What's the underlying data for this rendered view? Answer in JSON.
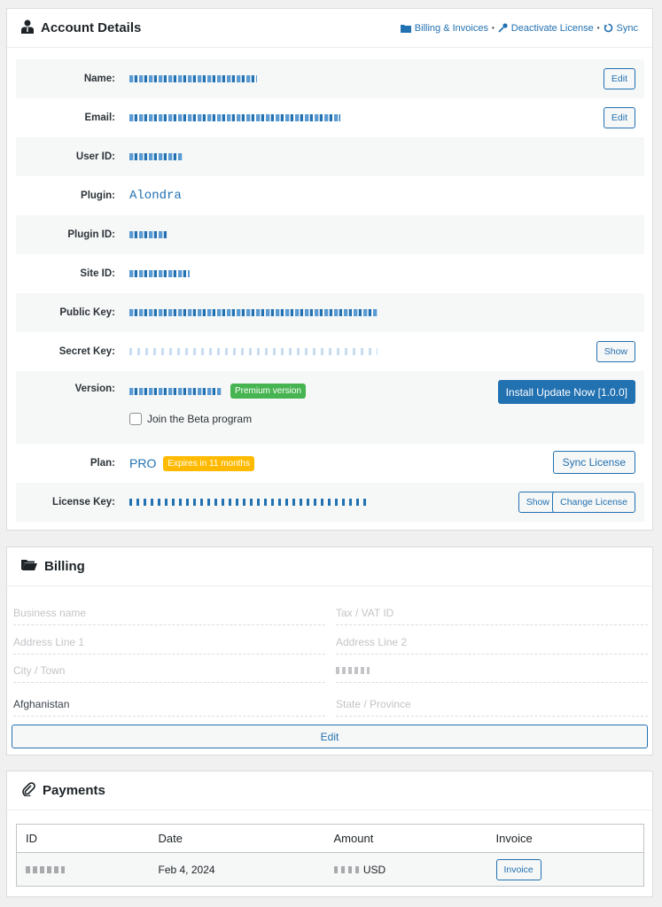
{
  "account": {
    "title": "Account Details",
    "links": {
      "billing": "Billing & Invoices",
      "deactivate": "Deactivate License",
      "sync": "Sync"
    },
    "rows": {
      "name_label": "Name:",
      "email_label": "Email:",
      "userid_label": "User ID:",
      "plugin_label": "Plugin:",
      "plugin_value": "Alondra",
      "pluginid_label": "Plugin ID:",
      "siteid_label": "Site ID:",
      "publickey_label": "Public Key:",
      "secretkey_label": "Secret Key:",
      "version_label": "Version:",
      "version_badge": "Premium version",
      "beta_label": "Join the Beta program",
      "plan_label": "Plan:",
      "plan_value": "PRO",
      "plan_badge": "Expires in 11 months",
      "licensekey_label": "License Key:"
    },
    "buttons": {
      "edit_name": "Edit",
      "edit_email": "Edit",
      "show_secret": "Show",
      "install_update": "Install Update Now [1.0.0]",
      "sync_license": "Sync License",
      "show_license": "Show",
      "change_license": "Change License"
    }
  },
  "billing": {
    "title": "Billing",
    "fields": {
      "business_name": "Business name",
      "tax_vat": "Tax / VAT ID",
      "address1": "Address Line 1",
      "address2": "Address Line 2",
      "city": "City / Town",
      "country": "Afghanistan",
      "state": "State / Province"
    },
    "edit_button": "Edit"
  },
  "payments": {
    "title": "Payments",
    "columns": {
      "id": "ID",
      "date": "Date",
      "amount": "Amount",
      "invoice": "Invoice"
    },
    "row": {
      "date": "Feb 4, 2024",
      "currency": "USD",
      "invoice_button": "Invoice"
    }
  },
  "colors": {
    "accent": "#2271b1",
    "premium_badge": "#46b450",
    "expiry_badge": "#ffba00"
  }
}
